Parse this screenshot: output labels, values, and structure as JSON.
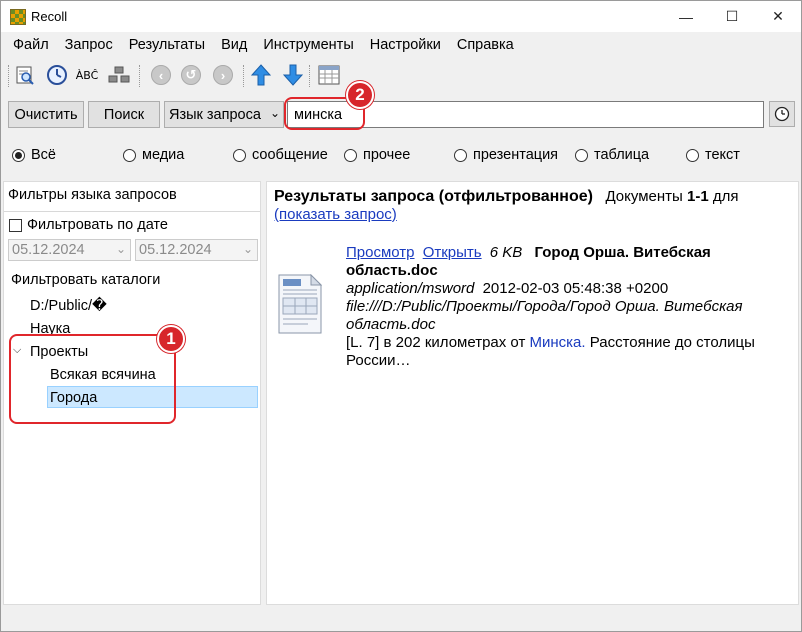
{
  "window": {
    "title": "Recoll",
    "min_icon": "—",
    "max_icon": "☐",
    "close_icon": "✕"
  },
  "menu": [
    "Файл",
    "Запрос",
    "Результаты",
    "Вид",
    "Инструменты",
    "Настройки",
    "Справка"
  ],
  "toolbar": {
    "icons": [
      "search-preview-icon",
      "history-icon",
      "spell-icon",
      "index-icon",
      "back-icon",
      "reload-icon",
      "forward-icon",
      "up-arrow-icon",
      "down-arrow-icon",
      "table-view-icon"
    ],
    "spell_glyph": "ÀBĈ"
  },
  "search": {
    "clear_label": "Очистить",
    "search_label": "Поиск",
    "query_lang_label": "Язык запроса",
    "query_value": "минска"
  },
  "filters": [
    {
      "label": "Всё",
      "selected": true
    },
    {
      "label": "медиа",
      "selected": false
    },
    {
      "label": "сообщение",
      "selected": false
    },
    {
      "label": "прочее",
      "selected": false
    },
    {
      "label": "презентация",
      "selected": false
    },
    {
      "label": "таблица",
      "selected": false
    },
    {
      "label": "текст",
      "selected": false
    }
  ],
  "left_panel": {
    "title": "Фильтры языка запросов",
    "date_filter_label": "Фильтровать по дате",
    "date_from": "05.12.2024",
    "date_to": "05.12.2024",
    "dir_filter_label": "Фильтровать каталоги",
    "tree": {
      "root": "D:/Public/�",
      "item1": "Наука",
      "item2": "Проекты",
      "child1": "Всякая всячина",
      "child2": "Города"
    }
  },
  "results": {
    "header_title": "Результаты запроса (отфильтрованное)",
    "docs_label": "Документы",
    "docs_range": "1-1",
    "docs_suffix": "для",
    "show_query_link": "(показать запрос)",
    "entry": {
      "preview_link": "Просмотр",
      "open_link": "Открыть",
      "size": "6 KB",
      "title_line1": "Город Орша. Витебская",
      "title_line2": "область.doc",
      "mime": "application/msword",
      "date": "2012-02-03 05:48:38 +0200",
      "path_line1": "file:///D:/Public/Проекты/Города/Город Орша. Витебская",
      "path_line2": "область.doc",
      "snippet_pre": "[L. 7] в 202 километрах от ",
      "snippet_hl": "Минска.",
      "snippet_post": " Расстояние до столицы",
      "snippet_line2": "России…"
    }
  },
  "annotations": {
    "badge1": "1",
    "badge2": "2",
    "color": "#d7262b"
  }
}
